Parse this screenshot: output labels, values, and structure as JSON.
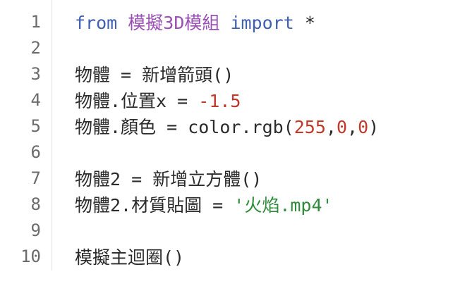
{
  "editor": {
    "line_numbers": [
      "1",
      "2",
      "3",
      "4",
      "5",
      "6",
      "7",
      "8",
      "9",
      "10"
    ],
    "colors": {
      "keyword": "#3f5fb0",
      "module": "#9a4fb5",
      "number": "#c0392b",
      "string": "#2e8b3a",
      "default": "#2b2b2b"
    },
    "lines": {
      "l1": {
        "t1": "from",
        "t2": " ",
        "t3": "模擬3D模組",
        "t4": " ",
        "t5": "import",
        "t6": " *"
      },
      "l2": {
        "text": ""
      },
      "l3": {
        "text": "物體 = 新增箭頭()"
      },
      "l4": {
        "t1": "物體.位置x = ",
        "t2": "-1.5"
      },
      "l5": {
        "t1": "物體.顏色 = color.rgb(",
        "t2": "255",
        "t3": ",",
        "t4": "0",
        "t5": ",",
        "t6": "0",
        "t7": ")"
      },
      "l6": {
        "text": ""
      },
      "l7": {
        "text": "物體2 = 新增立方體()"
      },
      "l8": {
        "t1": "物體2.材質貼圖 = ",
        "t2": "'火焰.mp4'"
      },
      "l9": {
        "text": ""
      },
      "l10": {
        "text": "模擬主迴圈()"
      }
    }
  }
}
